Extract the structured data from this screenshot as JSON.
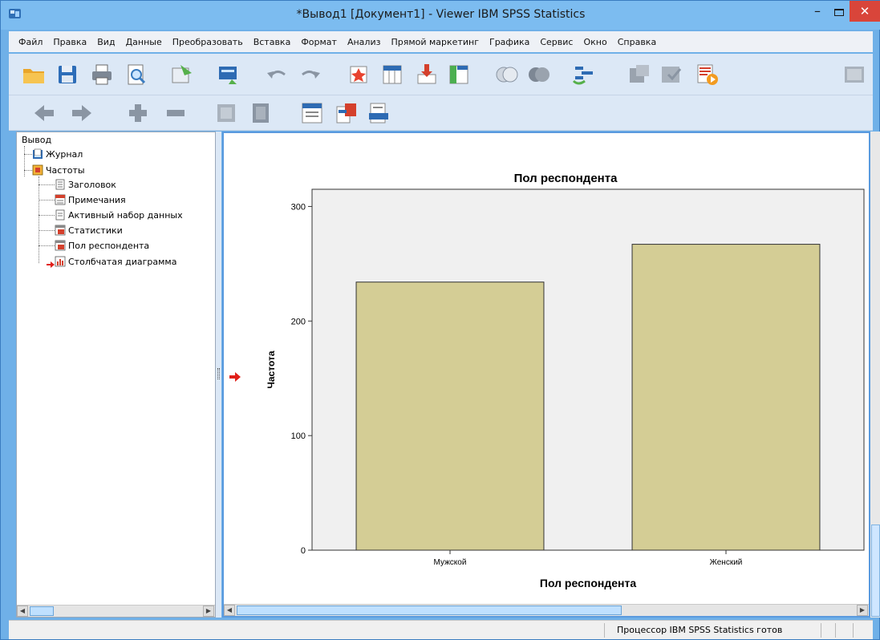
{
  "window": {
    "title": "*Вывод1 [Документ1] - Viewer IBM SPSS Statistics",
    "minimize_label": "–",
    "close_label": "✕"
  },
  "menu": {
    "items": [
      "Файл",
      "Правка",
      "Вид",
      "Данные",
      "Преобразовать",
      "Вставка",
      "Формат",
      "Анализ",
      "Прямой маркетинг",
      "Графика",
      "Сервис",
      "Окно",
      "Справка"
    ]
  },
  "outline": {
    "root": "Вывод",
    "nodes": [
      {
        "label": "Журнал",
        "icon": "log-icon"
      },
      {
        "label": "Частоты",
        "icon": "procedure-icon"
      },
      {
        "label": "Заголовок",
        "icon": "title-icon"
      },
      {
        "label": "Примечания",
        "icon": "notes-icon"
      },
      {
        "label": "Активный набор данных",
        "icon": "dataset-icon"
      },
      {
        "label": "Статистики",
        "icon": "table-icon"
      },
      {
        "label": "Пол респондента",
        "icon": "table-icon"
      },
      {
        "label": "Столбчатая диаграмма",
        "icon": "chart-icon"
      }
    ]
  },
  "chart_data": {
    "type": "bar",
    "title": "Пол респондента",
    "xlabel": "Пол респондента",
    "ylabel": "Частота",
    "categories": [
      "Мужской",
      "Женский"
    ],
    "values": [
      234,
      267
    ],
    "ylim": [
      0,
      315
    ],
    "yticks": [
      0,
      100,
      200,
      300
    ],
    "bar_color": "#d4cd95",
    "plot_background": "#f0f0f0"
  },
  "status": {
    "text": "Процессор IBM SPSS Statistics  готов"
  },
  "colors": {
    "accent": "#5a9ade",
    "titlebar": "#7cbcf0",
    "close": "#d9453a"
  }
}
